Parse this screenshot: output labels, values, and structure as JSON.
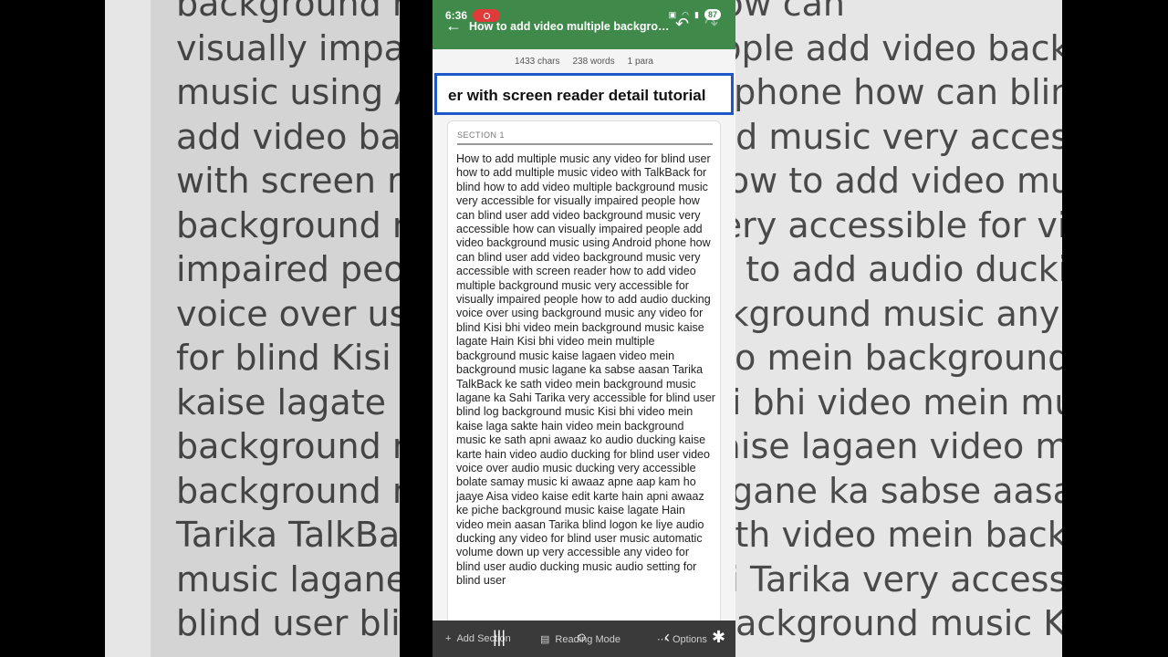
{
  "background_lines": [
    "background music how can",
    "visually impaired people add video background",
    "music using Android phone how can blind user",
    "add video background music very accessible",
    "with screen reader how to add video multiple",
    "background music very accessible for visually",
    "impaired people how to add audio ducking",
    "voice over using background music any video",
    "for blind Kisi bhi video mein background music",
    "kaise lagate Hain Kisi bhi video mein multiple",
    "background music kaise lagaen video mein",
    "background music lagane ka sabse aasan",
    "Tarika TalkBack ke sath video mein background",
    "music lagane ka Sahi Tarika very accessible for",
    "blind user blind log background music Kisi bhi"
  ],
  "status": {
    "time": "6:36",
    "battery": "87"
  },
  "app": {
    "title": "How to add video multiple backgrou…",
    "back_icon": "arrow-left-icon",
    "undo_icon": "undo-icon",
    "redo_icon": "redo-icon"
  },
  "stats": {
    "chars": "1433 chars",
    "words": "238 words",
    "paras": "1 para"
  },
  "title_field": {
    "value": "er with screen reader detail tutorial"
  },
  "section": {
    "label": "SECTION 1",
    "body": "How to add multiple music any video for blind user how to add multiple music video with TalkBack for blind how to add video multiple background music very accessible for visually impaired people how can blind user add video background music very accessible how can visually impaired people add video background music using Android phone how can blind user add video background music very accessible with screen reader how to add video multiple background music very accessible for visually impaired people how to add audio ducking voice over using background music any video for blind Kisi bhi video mein background music kaise lagate Hain Kisi bhi video mein multiple background music kaise lagaen video mein background music lagane ka sabse aasan Tarika TalkBack ke sath video mein background music lagane ka Sahi Tarika very accessible for blind user blind log background music Kisi bhi video mein kaise laga sakte hain video mein background music ke sath apni awaaz ko audio ducking kaise karte hain video audio ducking for blind user video voice over audio music ducking very accessible bolate samay music ki awaaz apne aap kam ho jaaye Aisa video kaise edit karte hain apni awaaz ke piche background music kaise lagate Hain video mein aasan Tarika blind logon ke liye audio ducking any video for blind user music automatic volume down up very accessible any video for blind user audio ducking music audio setting for blind user"
  },
  "bottom": {
    "add_section": "Add Section",
    "reading_mode": "Reading Mode",
    "options": "Options"
  },
  "colors": {
    "appbar": "#3f8a4a",
    "focus": "#1f57c8"
  }
}
